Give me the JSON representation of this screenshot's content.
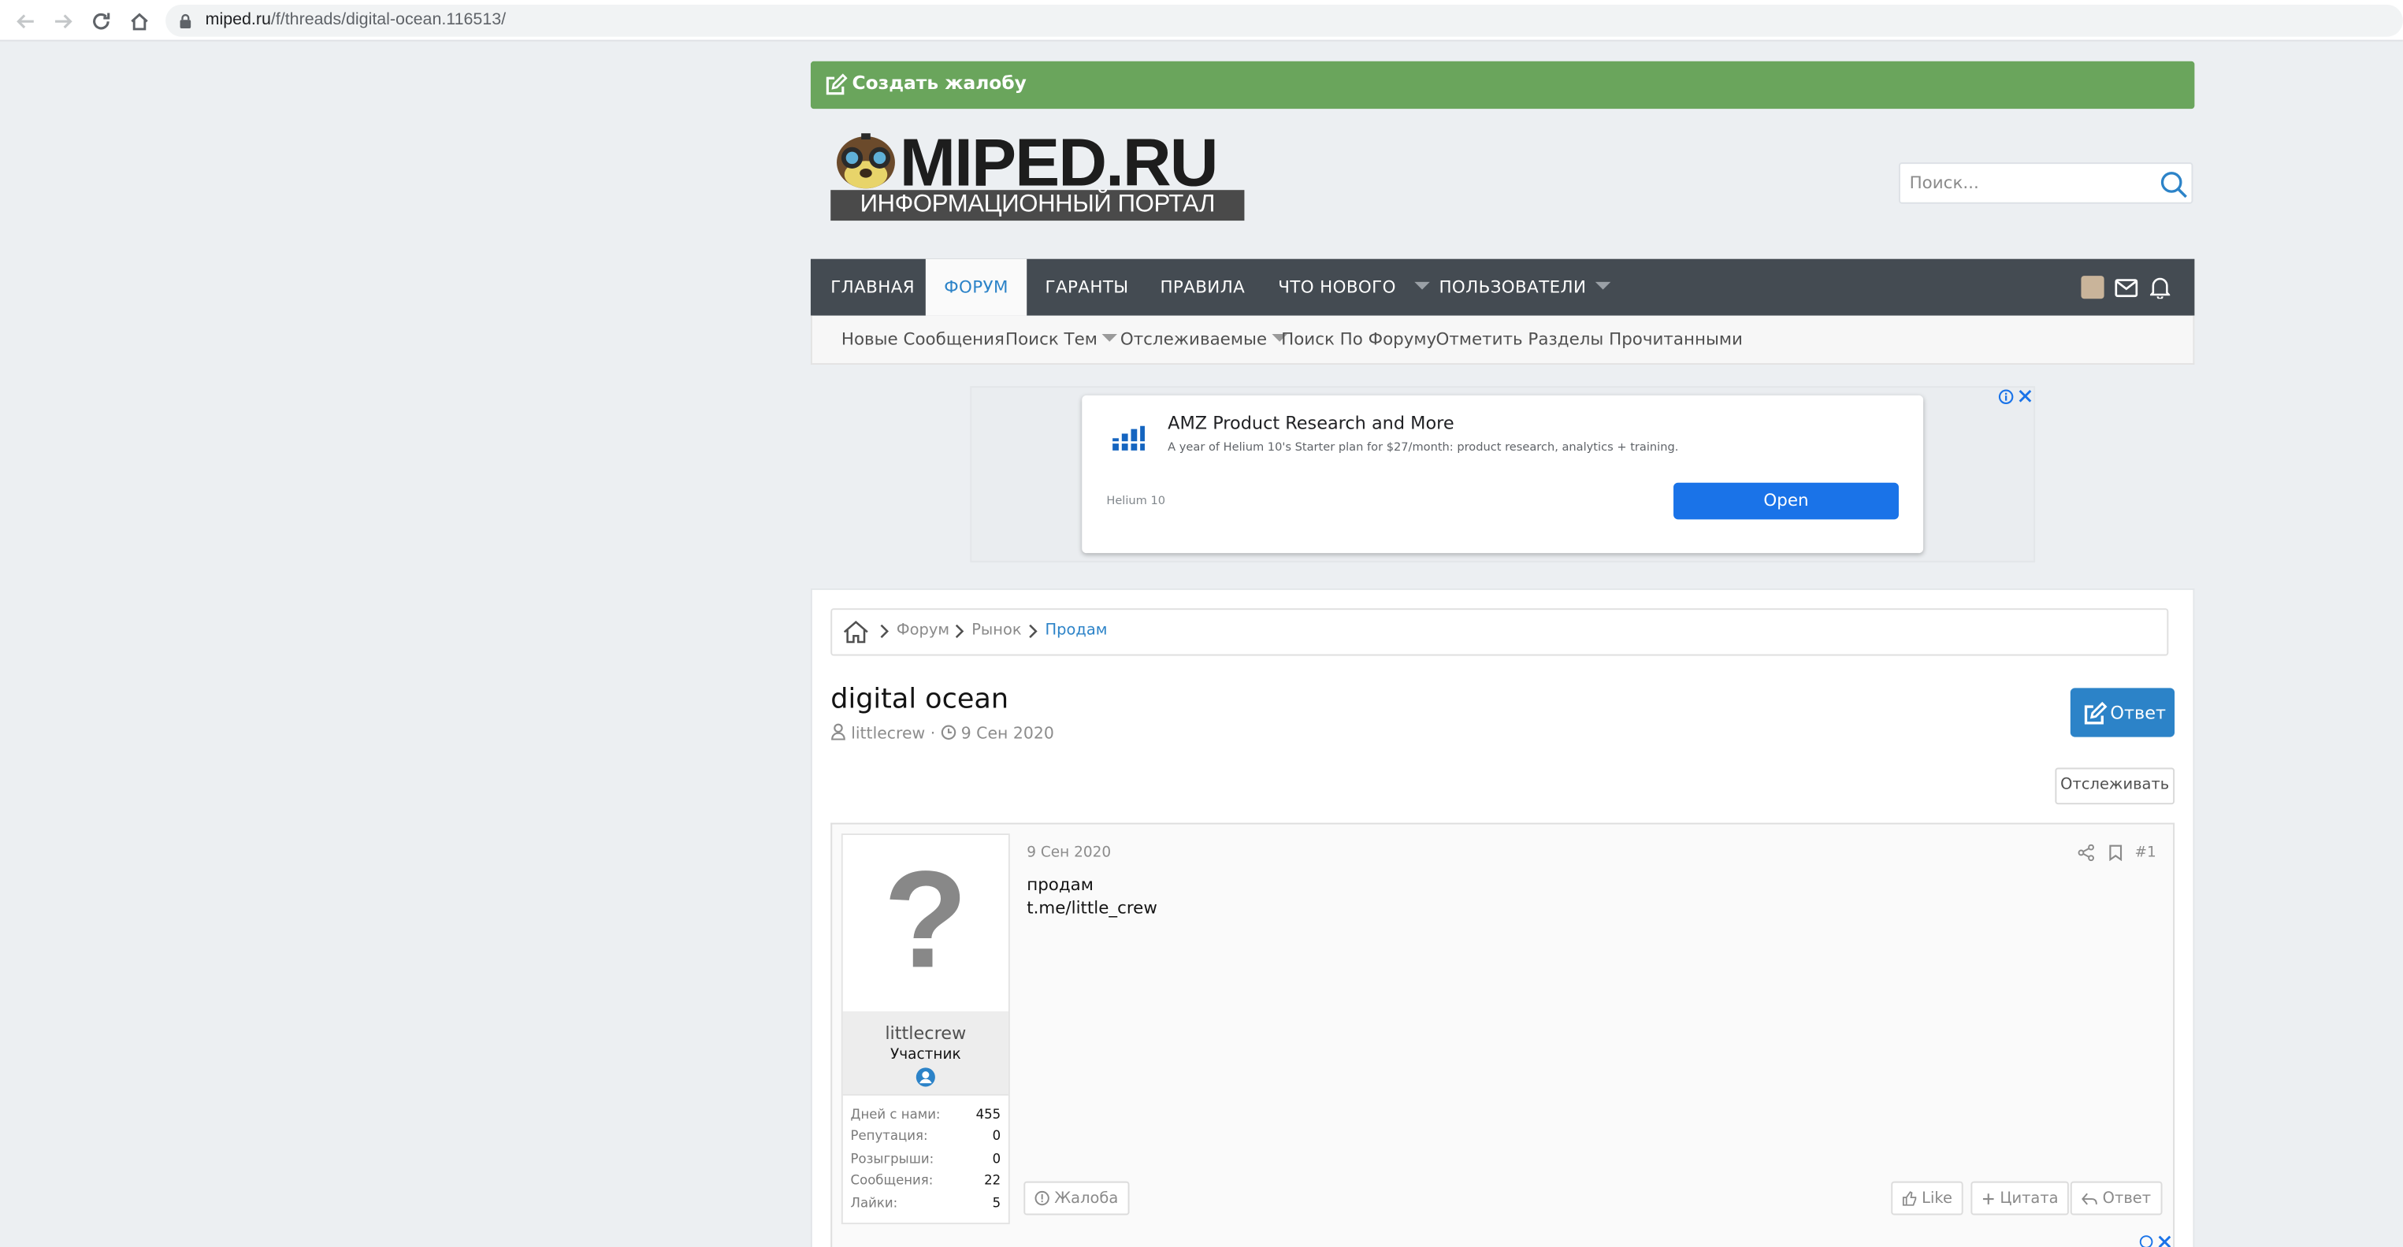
{
  "browser": {
    "url_host": "miped.ru",
    "url_path": "/f/threads/digital-ocean.116513/"
  },
  "complaint_bar": {
    "label": "Создать жалобу"
  },
  "logo": {
    "word": "MIPED.RU",
    "subtitle": "ИНФОРМАЦИОННЫЙ ПОРТАЛ"
  },
  "search": {
    "placeholder": "Поиск..."
  },
  "nav": {
    "items": [
      "ГЛАВНАЯ",
      "ФОРУМ",
      "ГАРАНТЫ",
      "ПРАВИЛА",
      "ЧТО НОВОГО",
      "ПОЛЬЗОВАТЕЛИ"
    ],
    "active": "ФОРУМ"
  },
  "subnav": {
    "items": [
      "Новые Сообщения",
      "Поиск Тем",
      "Отслеживаемые",
      "Поиск По Форуму",
      "Отметить Разделы Прочитанными"
    ]
  },
  "ad": {
    "title": "AMZ Product Research and More",
    "desc": "A year of Helium 10's Starter plan for $27/month: product research, analytics + training.",
    "brand": "Helium 10",
    "cta": "Open"
  },
  "breadcrumb": [
    "Форум",
    "Рынок",
    "Продам"
  ],
  "thread": {
    "title": "digital ocean",
    "author": "littlecrew",
    "date": "9 Сен 2020",
    "reply_button": "Ответ",
    "watch_button": "Отслеживать"
  },
  "post": {
    "avatar_char": "?",
    "username": "littlecrew",
    "role": "Участник",
    "stats": [
      {
        "label": "Дней с нами:",
        "value": "455"
      },
      {
        "label": "Репутация:",
        "value": "0"
      },
      {
        "label": "Розыгрыши:",
        "value": "0"
      },
      {
        "label": "Сообщения:",
        "value": "22"
      },
      {
        "label": "Лайки:",
        "value": "5"
      }
    ],
    "date": "9 Сен 2020",
    "number": "#1",
    "lines": [
      "продам",
      "t.me/little_crew"
    ],
    "report": "Жалоба",
    "like": "Like",
    "quote": "Цитата",
    "reply": "Ответ"
  },
  "colors": {
    "complaint_bg": "#6aa55c",
    "nav_bg": "#444b52",
    "accent": "#2c83c8",
    "ad_button": "#1a73e8"
  }
}
